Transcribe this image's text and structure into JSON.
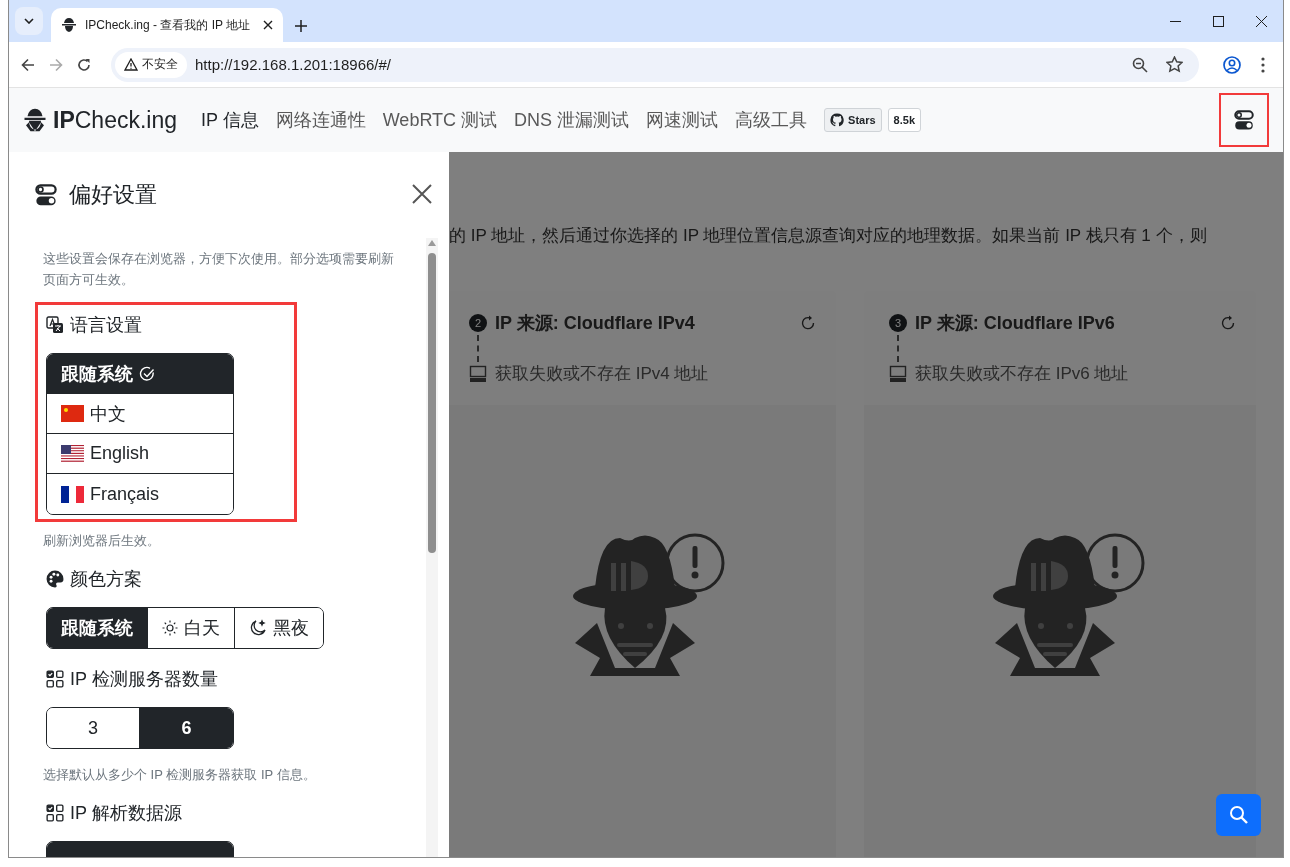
{
  "browser": {
    "tab_title": "IPCheck.ing - 查看我的 IP 地址",
    "security_label": "不安全",
    "url": "http://192.168.1.201:18966/#/"
  },
  "navbar": {
    "brand": "**IP**Check.ing",
    "items": [
      {
        "label": "IP 信息",
        "selected": true
      },
      {
        "label": "网络连通性",
        "selected": false
      },
      {
        "label": "WebRTC 测试",
        "selected": false
      },
      {
        "label": "DNS 泄漏测试",
        "selected": false
      },
      {
        "label": "网速测试",
        "selected": false
      },
      {
        "label": "高级工具",
        "selected": false
      }
    ],
    "github": {
      "label": "Stars",
      "count": "8.5k"
    }
  },
  "page": {
    "intro": "的 IP 地址，然后通过你选择的 IP 地理位置信息源查询对应的地理数据。如果当前 IP 栈只有 1 个，则",
    "cards": [
      {
        "number": "2",
        "title": "IP 来源: Cloudflare IPv4",
        "status": "获取失败或不存在 IPv4 地址"
      },
      {
        "number": "3",
        "title": "IP 来源: Cloudflare IPv6",
        "status": "获取失败或不存在 IPv6 地址"
      }
    ]
  },
  "preferences": {
    "title": "偏好设置",
    "description": "这些设置会保存在浏览器，方便下次使用。部分选项需要刷新页面方可生效。",
    "sections": [
      {
        "kind": "language",
        "title": "语言设置",
        "highlighted": true,
        "vertical": true,
        "note": "刷新浏览器后生效。",
        "options": [
          {
            "kind": "system",
            "label": "跟随系统",
            "selected": true
          },
          {
            "kind": "cn",
            "label": "中文",
            "selected": false
          },
          {
            "kind": "us",
            "label": "English",
            "selected": false
          },
          {
            "kind": "fr",
            "label": "Français",
            "selected": false
          }
        ]
      },
      {
        "kind": "palette",
        "title": "颜色方案",
        "highlighted": false,
        "vertical": false,
        "options": [
          {
            "kind": "auto",
            "label": "跟随系统",
            "selected": true
          },
          {
            "kind": "day",
            "label": "白天",
            "selected": false
          },
          {
            "kind": "night",
            "label": "黑夜",
            "selected": false
          }
        ]
      },
      {
        "kind": "grid",
        "title": "IP 检测服务器数量",
        "highlighted": false,
        "vertical": false,
        "note": "选择默认从多少个 IP 检测服务器获取 IP 信息。",
        "options": [
          {
            "kind": "plain",
            "label": "3",
            "selected": false
          },
          {
            "kind": "plain",
            "label": "6",
            "selected": true
          }
        ]
      },
      {
        "kind": "grid",
        "title": "IP 解析数据源",
        "highlighted": false,
        "vertical": true,
        "options": [
          {
            "kind": "blank",
            "selected": true
          }
        ]
      }
    ]
  },
  "settings_button": {
    "highlighted": true
  }
}
